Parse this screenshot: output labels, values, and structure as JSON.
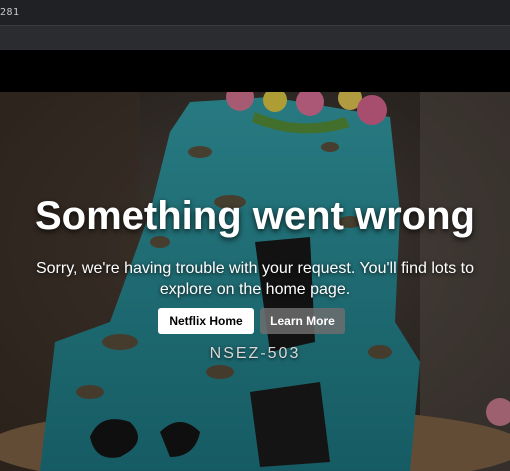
{
  "browser": {
    "address_text": "281"
  },
  "error": {
    "title": "Something went wrong",
    "message": "Sorry, we're having trouble with your request. You'll find lots to explore on the home page.",
    "home_button": "Netflix Home",
    "learn_more_button": "Learn More",
    "code": "NSEZ-503"
  },
  "colors": {
    "page_background": "#141414",
    "home_button_bg": "#ffffff",
    "learn_more_bg": "#6d6d6e",
    "cake_frosting": "#2a9aa5"
  }
}
